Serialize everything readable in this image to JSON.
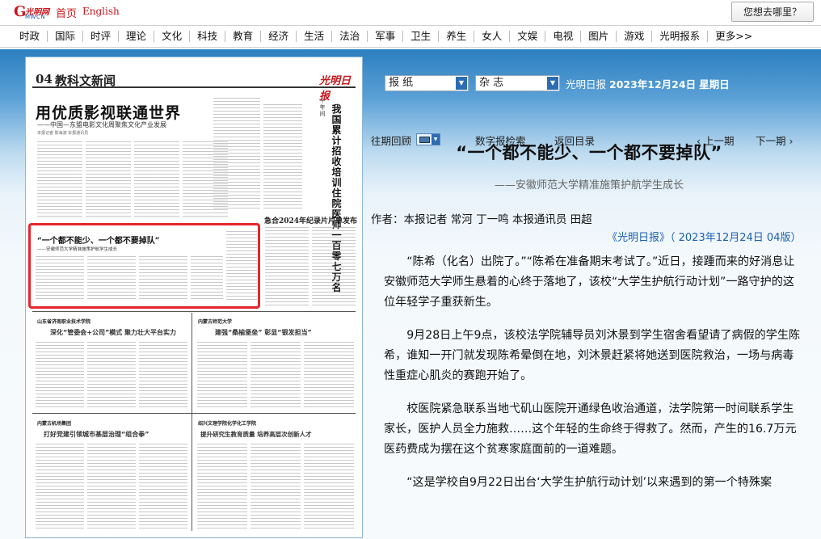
{
  "header": {
    "logo_g": "G",
    "logo_script": "光明网",
    "logo_sub": "MWCN",
    "home_link": "首页",
    "english_link": "English",
    "where_button": "您想去哪里？"
  },
  "nav": {
    "items": [
      "时政",
      "国际",
      "时评",
      "理论",
      "文化",
      "科技",
      "教育",
      "经济",
      "生活",
      "法治",
      "军事",
      "卫生",
      "养生",
      "女人",
      "文娱",
      "电视",
      "图片",
      "游戏",
      "光明报系",
      "更多>>"
    ]
  },
  "toolbar": {
    "paper_select": "报  纸",
    "magazine_select": "杂  志",
    "paper_name": "光明日报",
    "date": "2023年12月24日",
    "weekday": "星期日",
    "past_review": "往期回顾",
    "digital_search": "数字报检索",
    "back_to_index": "返回目录",
    "prev_page": "上一期",
    "next_page": "下一期"
  },
  "newspaper": {
    "page_num": "04",
    "section": "教科文新闻",
    "masthead": "光明日报",
    "headline": "用优质影视联通世界",
    "subheadline": "——中国—东盟电影文化周聚焦文化产业发展",
    "byline": "本报记者  陈海波  本报通讯员",
    "vertical_title": "我国累计招收培训住院医师一百零七万名",
    "vertical_kicker": "十年间",
    "release_title": "急合2024年纪录片片单发布",
    "box_title": "“一个都不能少、一个都不要掉队”",
    "box_sub": "——安徽师范大学精准施策护航学生成长",
    "section_label_1": "山东省济南职业技术学院",
    "story_title_1": "深化“管委会+公司”模式  聚力壮大平台实力",
    "section_label_2": "内蒙古师范大学",
    "story_title_2": "建强“桑榆堡垒”  彰显“银发担当”",
    "section_label_3": "内蒙古机场集团",
    "story_title_3": "打好党建引领城市基层治理“组合拳”",
    "section_label_4": "绍兴文理学院化学化工学院",
    "story_title_4": "提升研究生教育质量  培养高层次创新人才"
  },
  "article": {
    "title": "“一个都不能少、一个都不要掉队”",
    "subtitle": "——安徽师范大学精准施策护航学生成长",
    "author": "作者：本报记者  常河  丁一鸣  本报通讯员  田超",
    "source": "《光明日报》（ 2023年12月24日   04版）",
    "paragraphs": [
      "“陈希（化名）出院了。”“陈希在准备期末考试了。”近日，接踵而来的好消息让安徽师范大学师生悬着的心终于落地了，该校“大学生护航行动计划”一路守护的这位年轻学子重获新生。",
      "9月28日上午9点，该校法学院辅导员刘沐景到学生宿舍看望请了病假的学生陈希，谁知一开门就发现陈希晕倒在地，刘沐景赶紧将她送到医院救治，一场与病毒性重症心肌炎的赛跑开始了。",
      "校医院紧急联系当地弋矶山医院开通绿色收治通道，法学院第一时间联系学生家长，医护人员全力施救……这个年轻的生命终于得救了。然而，产生的16.7万元医药费成为摆在这个贫寒家庭面前的一道难题。",
      "“这是学校自9月22日出台‘大学生护航行动计划’以来遇到的第一个特殊案"
    ]
  }
}
